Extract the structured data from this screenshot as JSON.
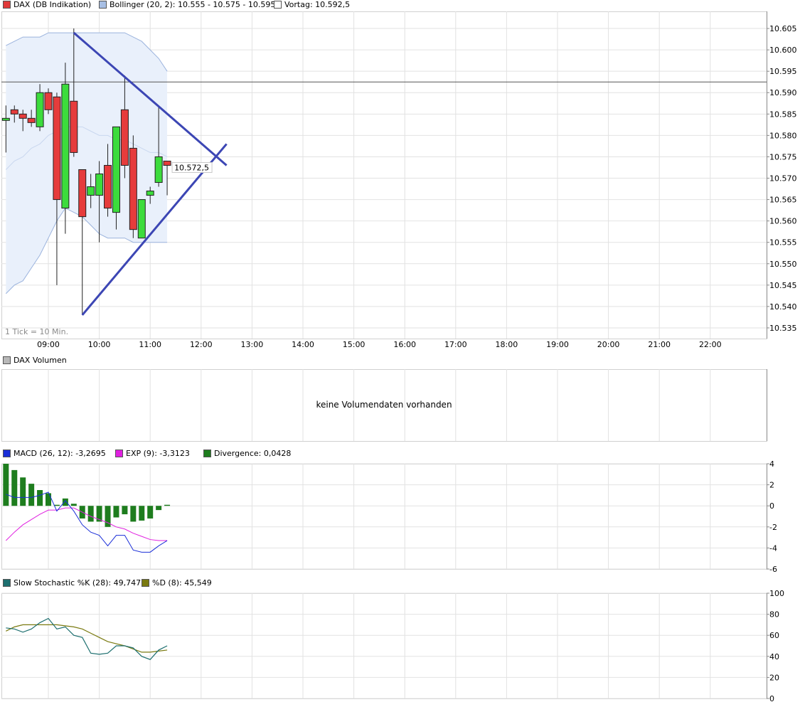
{
  "price_legend": [
    {
      "label": "DAX (DB Indikation)",
      "color": "#e03a3a"
    },
    {
      "label": "Bollinger (20, 2): 10.555 - 10.575 - 10.595",
      "color": "#a8bfe4"
    },
    {
      "label": "Vortag: 10.592,5",
      "color": "#ffffff"
    }
  ],
  "volume_legend": [
    {
      "label": "DAX Volumen",
      "color": "#b8b8b8"
    }
  ],
  "macd_legend": [
    {
      "label": "MACD (26, 12): -3,2695",
      "color": "#1a2ed8"
    },
    {
      "label": "EXP (9): -3,3123",
      "color": "#e020e0"
    },
    {
      "label": "Divergence: 0,0428",
      "color": "#1e7d1e"
    }
  ],
  "stoch_legend": [
    {
      "label": "Slow Stochastic %K (28): 49,747",
      "color": "#1d6f6f"
    },
    {
      "label": "%D (8): 45,549",
      "color": "#7a7a10"
    }
  ],
  "tick_note": "1 Tick = 10 Min.",
  "last_price_label": "10.572,5",
  "no_volume_text": "keine Volumendaten vorhanden",
  "colors": {
    "up": "#3cdc3c",
    "down": "#e63c3c",
    "band": "#e9f0fb",
    "band_line": "#9bb3dd",
    "trend": "#3c46b4",
    "macd": "#1a2ed8",
    "exp": "#e020e0",
    "div": "#1e7d1e",
    "k": "#1d6f6f",
    "d": "#7a7a10"
  },
  "chart_data": [
    {
      "type": "candlestick",
      "title": "DAX (DB Indikation)",
      "x_ticks": [
        "09:00",
        "10:00",
        "11:00",
        "12:00",
        "13:00",
        "14:00",
        "15:00",
        "16:00",
        "17:00",
        "18:00",
        "19:00",
        "20:00",
        "21:00",
        "22:00"
      ],
      "ylim": [
        10532.5,
        10609
      ],
      "y_ticks": [
        "10.535",
        "10.540",
        "10.545",
        "10.550",
        "10.555",
        "10.560",
        "10.565",
        "10.570",
        "10.575",
        "10.580",
        "10.585",
        "10.590",
        "10.595",
        "10.600",
        "10.605"
      ],
      "y_tick_values": [
        10535,
        10540,
        10545,
        10550,
        10555,
        10560,
        10565,
        10570,
        10575,
        10580,
        10585,
        10590,
        10595,
        10600,
        10605
      ],
      "start_time": "08:10",
      "interval_min": 10,
      "candles": [
        {
          "o": 10584,
          "h": 10587,
          "l": 10576,
          "c": 10584
        },
        {
          "o": 10586,
          "h": 10587,
          "l": 10583,
          "c": 10585
        },
        {
          "o": 10585,
          "h": 10586,
          "l": 10581,
          "c": 10584
        },
        {
          "o": 10584,
          "h": 10586,
          "l": 10582,
          "c": 10583
        },
        {
          "o": 10582,
          "h": 10592,
          "l": 10581,
          "c": 10590
        },
        {
          "o": 10590,
          "h": 10591,
          "l": 10585,
          "c": 10586
        },
        {
          "o": 10589,
          "h": 10590,
          "l": 10545,
          "c": 10565
        },
        {
          "o": 10563,
          "h": 10597,
          "l": 10557,
          "c": 10592
        },
        {
          "o": 10588,
          "h": 10605,
          "l": 10575,
          "c": 10576
        },
        {
          "o": 10572,
          "h": 10572,
          "l": 10538,
          "c": 10561
        },
        {
          "o": 10566,
          "h": 10571,
          "l": 10563,
          "c": 10568
        },
        {
          "o": 10566,
          "h": 10574,
          "l": 10555,
          "c": 10571
        },
        {
          "o": 10573,
          "h": 10578,
          "l": 10561,
          "c": 10563
        },
        {
          "o": 10562,
          "h": 10582,
          "l": 10558,
          "c": 10582
        },
        {
          "o": 10586,
          "h": 10594,
          "l": 10570,
          "c": 10573
        },
        {
          "o": 10577,
          "h": 10580,
          "l": 10556,
          "c": 10558
        },
        {
          "o": 10556,
          "h": 10565,
          "l": 10556,
          "c": 10565
        },
        {
          "o": 10566,
          "h": 10568,
          "l": 10564,
          "c": 10567
        },
        {
          "o": 10569,
          "h": 10587,
          "l": 10568,
          "c": 10575
        },
        {
          "o": 10574,
          "h": 10574,
          "l": 10566,
          "c": 10573
        }
      ],
      "bollinger_upper": [
        10601,
        10602,
        10603,
        10603,
        10603,
        10604,
        10604,
        10604,
        10604,
        10604,
        10604,
        10604,
        10604,
        10604,
        10604,
        10603,
        10602,
        10600,
        10598,
        10595
      ],
      "bollinger_lower": [
        10543,
        10545,
        10546,
        10549,
        10552,
        10556,
        10560,
        10563,
        10562,
        10561,
        10559,
        10557,
        10556,
        10556,
        10556,
        10555,
        10555,
        10555,
        10555,
        10555
      ],
      "bollinger_middle": [
        10572,
        10574,
        10575,
        10577,
        10578,
        10580,
        10581,
        10582,
        10582,
        10582,
        10581,
        10580,
        10580,
        10579,
        10579,
        10578,
        10577,
        10576,
        10576,
        10575
      ],
      "reference_line": {
        "label": "Vortag",
        "value": 10592.5
      },
      "trend_lines": [
        {
          "from": {
            "time": "09:30",
            "value": 10604
          },
          "to": {
            "time": "12:30",
            "value": 10573
          }
        },
        {
          "from": {
            "time": "09:40",
            "value": 10538
          },
          "to": {
            "time": "12:30",
            "value": 10578
          }
        }
      ]
    },
    {
      "type": "empty",
      "title": "DAX Volumen"
    },
    {
      "type": "line+bar",
      "title": "MACD (26, 12)",
      "ylim": [
        -6,
        4
      ],
      "y_ticks": [
        "4",
        "2",
        "0",
        "-2",
        "-4",
        "-6"
      ],
      "y_tick_values": [
        4,
        2,
        0,
        -2,
        -4,
        -6
      ],
      "series": [
        {
          "name": "MACD (26, 12)",
          "values": [
            1.1,
            0.8,
            0.8,
            0.8,
            1.0,
            1.3,
            -0.5,
            0.5,
            -0.5,
            -1.8,
            -2.5,
            -2.8,
            -3.8,
            -2.8,
            -2.8,
            -4.2,
            -4.4,
            -4.4,
            -3.8,
            -3.3
          ]
        },
        {
          "name": "EXP (9)",
          "values": [
            -3.3,
            -2.5,
            -1.8,
            -1.3,
            -0.8,
            -0.4,
            -0.4,
            -0.2,
            -0.2,
            -0.6,
            -1.0,
            -1.3,
            -1.6,
            -2.0,
            -2.2,
            -2.6,
            -2.9,
            -3.2,
            -3.3,
            -3.3
          ]
        },
        {
          "name": "Divergence",
          "type": "bar",
          "values": [
            4.0,
            3.4,
            2.7,
            2.1,
            1.5,
            1.2,
            0.1,
            0.7,
            0.2,
            -1.2,
            -1.5,
            -1.5,
            -2.0,
            -1.1,
            -0.8,
            -1.5,
            -1.4,
            -1.2,
            -0.4,
            0.1
          ]
        }
      ]
    },
    {
      "type": "line",
      "title": "Slow Stochastic",
      "ylim": [
        0,
        100
      ],
      "y_ticks": [
        "100",
        "80",
        "60",
        "40",
        "20",
        "0"
      ],
      "y_tick_values": [
        100,
        80,
        60,
        40,
        20,
        0
      ],
      "series": [
        {
          "name": "Slow Stochastic %K (28)",
          "values": [
            67,
            66,
            63,
            66,
            72,
            76,
            66,
            68,
            60,
            58,
            43,
            42,
            43,
            50,
            50,
            48,
            40,
            37,
            46,
            50
          ]
        },
        {
          "name": "%D (8)",
          "values": [
            64,
            68,
            70,
            70,
            70,
            70,
            70,
            69,
            68,
            66,
            62,
            58,
            54,
            52,
            50,
            47,
            44,
            44,
            45,
            46
          ]
        }
      ]
    }
  ]
}
